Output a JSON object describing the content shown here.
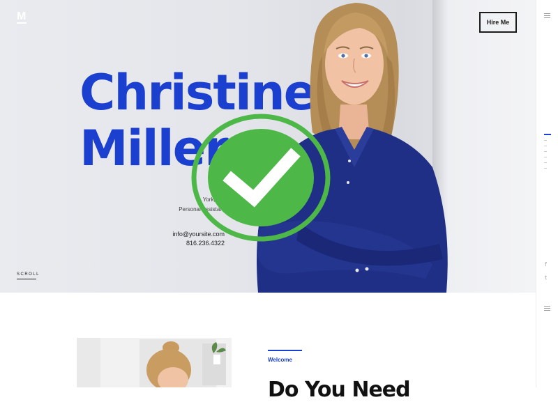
{
  "brand": {
    "logo": "M"
  },
  "header": {
    "hire_label": "Hire Me"
  },
  "hero": {
    "first_name": "Christine",
    "last_name": "Miller",
    "location": "York, NY",
    "role": "Personal Assistant",
    "email": "info@yoursite.com",
    "phone": "816.236.4322",
    "scroll_label": "SCROLL",
    "accent_color": "#1b3fcf"
  },
  "overlay": {
    "icon": "check-circle-icon",
    "color": "#4db847"
  },
  "rail": {
    "icons": [
      "menu-icon",
      "menu-icon"
    ],
    "social": [
      {
        "icon": "facebook-icon",
        "glyph": "f"
      },
      {
        "icon": "twitter-icon",
        "glyph": "t"
      }
    ]
  },
  "about": {
    "welcome_label": "Welcome",
    "heading": "Do You Need"
  }
}
